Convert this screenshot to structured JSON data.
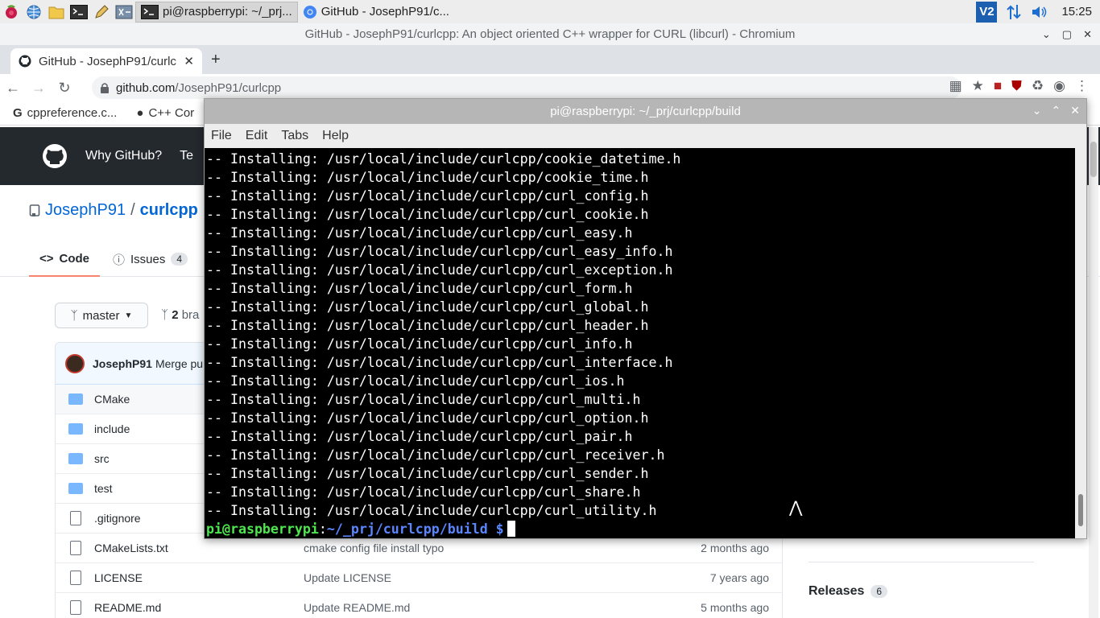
{
  "taskbar": {
    "tasks": [
      {
        "label": "pi@raspberrypi: ~/_prj..."
      },
      {
        "label": "GitHub - JosephP91/c..."
      }
    ],
    "vnc_label": "V2",
    "clock": "15:25"
  },
  "chromium": {
    "window_title": "GitHub - JosephP91/curlcpp: An object oriented C++ wrapper for CURL (libcurl) - Chromium",
    "tab_title": "GitHub - JosephP91/curlcpp",
    "url_host": "github.com",
    "url_path": "/JosephP91/curlcpp",
    "bookmarks": [
      {
        "label": "cppreference.c..."
      },
      {
        "label": "C++ Cor"
      }
    ]
  },
  "github": {
    "nav_why": "Why GitHub?",
    "nav_te": "Te",
    "owner": "JosephP91",
    "slash": "/",
    "repo": "curlcpp",
    "tab_code": "Code",
    "tab_issues": "Issues",
    "issues_count": "4",
    "branch": "master",
    "branches_count": "2",
    "branches_label": "bra",
    "commit_author": "JosephP91",
    "commit_message": "Merge pu",
    "files": [
      {
        "name": "CMake",
        "type": "folder",
        "message": "",
        "age": ""
      },
      {
        "name": "include",
        "type": "folder",
        "message": "",
        "age": ""
      },
      {
        "name": "src",
        "type": "folder",
        "message": "",
        "age": ""
      },
      {
        "name": "test",
        "type": "folder",
        "message": "",
        "age": ""
      },
      {
        "name": ".gitignore",
        "type": "file",
        "message": "",
        "age": ""
      },
      {
        "name": "CMakeLists.txt",
        "type": "file",
        "message": "cmake config file install typo",
        "age": "2 months ago"
      },
      {
        "name": "LICENSE",
        "type": "file",
        "message": "Update LICENSE",
        "age": "7 years ago"
      },
      {
        "name": "README.md",
        "type": "file",
        "message": "Update README.md",
        "age": "5 months ago"
      }
    ],
    "releases_label": "Releases",
    "releases_count": "6"
  },
  "terminal": {
    "title": "pi@raspberrypi: ~/_prj/curlcpp/build",
    "menu": [
      "File",
      "Edit",
      "Tabs",
      "Help"
    ],
    "lines": [
      "-- Installing: /usr/local/include/curlcpp/cookie_datetime.h",
      "-- Installing: /usr/local/include/curlcpp/cookie_time.h",
      "-- Installing: /usr/local/include/curlcpp/curl_config.h",
      "-- Installing: /usr/local/include/curlcpp/curl_cookie.h",
      "-- Installing: /usr/local/include/curlcpp/curl_easy.h",
      "-- Installing: /usr/local/include/curlcpp/curl_easy_info.h",
      "-- Installing: /usr/local/include/curlcpp/curl_exception.h",
      "-- Installing: /usr/local/include/curlcpp/curl_form.h",
      "-- Installing: /usr/local/include/curlcpp/curl_global.h",
      "-- Installing: /usr/local/include/curlcpp/curl_header.h",
      "-- Installing: /usr/local/include/curlcpp/curl_info.h",
      "-- Installing: /usr/local/include/curlcpp/curl_interface.h",
      "-- Installing: /usr/local/include/curlcpp/curl_ios.h",
      "-- Installing: /usr/local/include/curlcpp/curl_multi.h",
      "-- Installing: /usr/local/include/curlcpp/curl_option.h",
      "-- Installing: /usr/local/include/curlcpp/curl_pair.h",
      "-- Installing: /usr/local/include/curlcpp/curl_receiver.h",
      "-- Installing: /usr/local/include/curlcpp/curl_sender.h",
      "-- Installing: /usr/local/include/curlcpp/curl_share.h",
      "-- Installing: /usr/local/include/curlcpp/curl_utility.h"
    ],
    "prompt_user": "pi@raspberrypi",
    "prompt_sep": ":",
    "prompt_path": "~/_prj/curlcpp/build $"
  },
  "colors": {
    "prompt_user": "#4ee64e",
    "prompt_path": "#5b86ff",
    "github_header": "#24292e",
    "link": "#0366d6",
    "tab_underline": "#f9826c"
  }
}
